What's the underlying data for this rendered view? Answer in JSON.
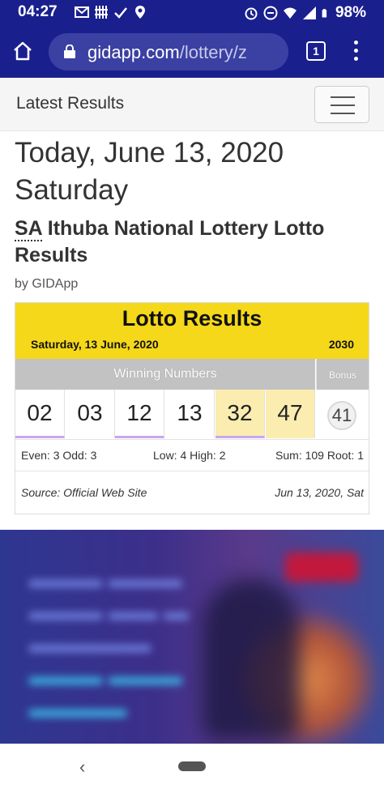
{
  "status_bar": {
    "time": "04:27",
    "battery": "98%",
    "icons": [
      "gmail-icon",
      "calendar-grid-icon",
      "check-icon",
      "location-icon",
      "alarm-icon",
      "dnd-icon",
      "wifi-icon",
      "signal-icon",
      "battery-icon"
    ]
  },
  "browser": {
    "url_host": "gidapp.com",
    "url_path": "/lottery/z",
    "tab_count": "1"
  },
  "site_nav": {
    "brand": "Latest Results"
  },
  "page": {
    "date_line1": "Today, June 13, 2020",
    "date_line2": "Saturday",
    "subtitle_abbr": "SA",
    "subtitle_rest": " Ithuba National Lottery Lotto Results",
    "byline": "by GIDApp"
  },
  "results": {
    "title": "Lotto Results",
    "draw_date": "Saturday, 13 June, 2020",
    "draw_number": "2030",
    "winning_header": "Winning Numbers",
    "bonus_header": "Bonus",
    "numbers": [
      "02",
      "03",
      "12",
      "13",
      "32",
      "47"
    ],
    "bonus": "41",
    "stats_even_odd": "Even: 3 Odd: 3",
    "stats_low_high": "Low: 4 High: 2",
    "stats_sum_root": "Sum: 109 Root: 1",
    "source": "Source: Official Web Site",
    "source_date": "Jun 13, 2020, Sat"
  },
  "colors": {
    "browser_bar": "#1a1f8e",
    "card_header": "#f5d81a",
    "header_gray": "#c2c2c2",
    "high_number_bg": "#fbecb0",
    "even_underline": "#c9a6f0"
  }
}
